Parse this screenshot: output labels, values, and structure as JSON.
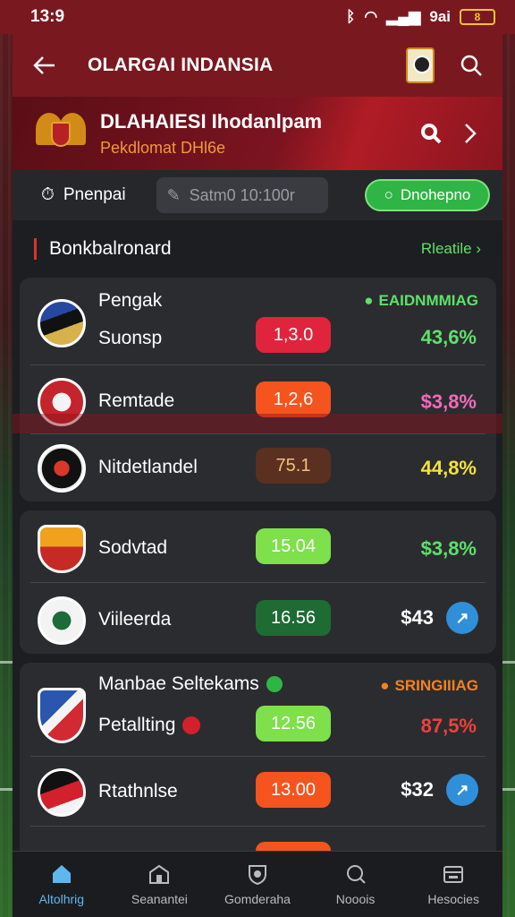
{
  "status_bar": {
    "time": "13:9",
    "network": "9ai",
    "battery": "8"
  },
  "app_bar": {
    "title": "OLARGAI INDANSIA"
  },
  "hero": {
    "title": "DLAHAIESI Ihodanlpam",
    "subtitle": "Pekdlomat DHl6e"
  },
  "filters": {
    "primary_label": "Pnenpai",
    "search_placeholder": "Satm0 10:100r",
    "active_chip": "Dnohepno"
  },
  "section": {
    "title": "Bonkbalronard",
    "link": "Rleatile"
  },
  "groups": [
    {
      "header_top": "Pengak",
      "status": "EAIDNMMIAG",
      "rows": [
        {
          "name": "Suonsp",
          "odds": "1,3.0",
          "value": "43,6%"
        },
        {
          "name": "Remtade",
          "odds": "1,2,6",
          "value": "$3,8%"
        },
        {
          "name": "Nitdetlandel",
          "odds": "75.1",
          "value": "44,8%"
        }
      ]
    },
    {
      "rows": [
        {
          "name": "Sodvtad",
          "odds": "15.04",
          "value": "$3,8%"
        },
        {
          "name": "Viileerda",
          "odds": "16.56",
          "value": "$43"
        }
      ]
    },
    {
      "header_top": "Manbae Seltekams",
      "status": "SRINGIIIAG",
      "rows": [
        {
          "name": "Petallting",
          "odds": "12.56",
          "value": "87,5%"
        },
        {
          "name": "Rtathnlse",
          "odds": "13.00",
          "value": "$32"
        }
      ]
    }
  ],
  "bottom_nav": [
    {
      "label": "Altolhrig",
      "icon": "home-icon"
    },
    {
      "label": "Seanantei",
      "icon": "shop-icon"
    },
    {
      "label": "Gomderaha",
      "icon": "shield-icon"
    },
    {
      "label": "Nooois",
      "icon": "search-icon"
    },
    {
      "label": "Hesocies",
      "icon": "wallet-icon"
    }
  ],
  "colors": {
    "brand": "#7a1820",
    "accent_green": "#2fb545",
    "accent_blue": "#5fb7ee"
  }
}
